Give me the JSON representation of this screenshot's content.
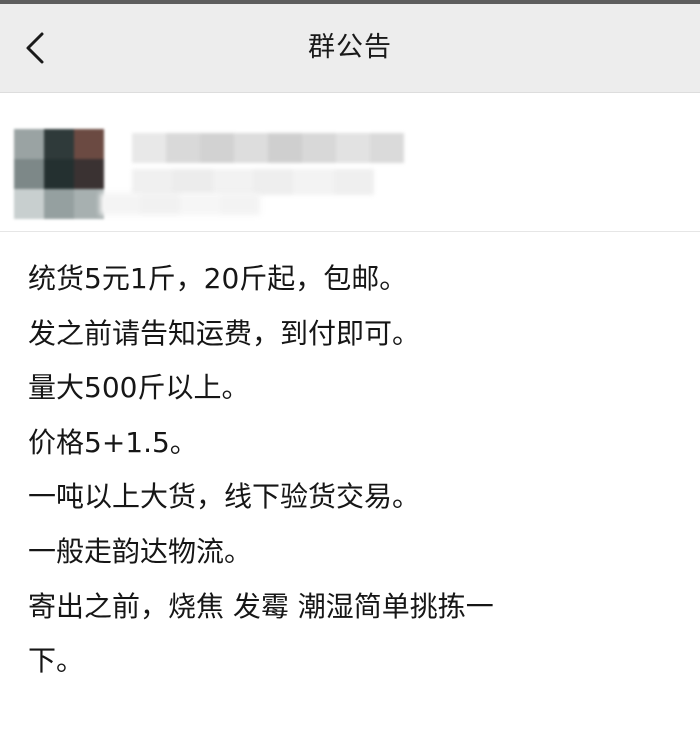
{
  "header": {
    "title": "群公告",
    "back_icon": "chevron-left-icon"
  },
  "notice": {
    "lines": [
      "统货5元1斤，20斤起，包邮。",
      "发之前请告知运费，到付即可。",
      "量大500斤以上。",
      "价格5+1.5。",
      "一吨以上大货，线下验货交易。",
      "一般走韵达物流。",
      "寄出之前，烧焦 发霉 潮湿简单挑拣一",
      "下。"
    ]
  },
  "colors": {
    "navbar_bg": "#ededed",
    "text": "#161616",
    "page_bg": "#ffffff"
  }
}
